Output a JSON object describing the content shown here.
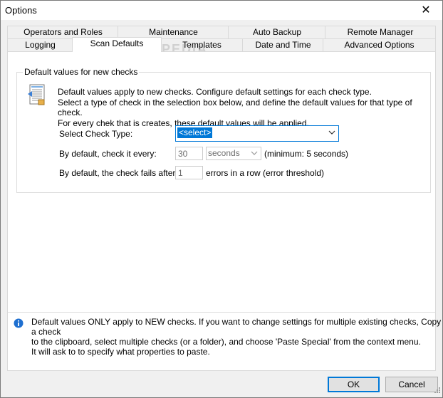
{
  "window": {
    "title": "Options",
    "close_glyph": "✕"
  },
  "tabs_back": [
    "Operators and Roles",
    "Maintenance",
    "Auto Backup",
    "Remote Manager"
  ],
  "tabs_front": [
    "Logging",
    "Scan Defaults",
    "Templates",
    "Date and Time",
    "Advanced Options"
  ],
  "selected_tab": "Scan Defaults",
  "watermark": "SOFTPEDIA",
  "group": {
    "label": "Default values for new checks",
    "description": [
      "Default values apply to new checks. Configure default settings for each check type.",
      "Select a type of check in the selection box below, and define the default values for that type of check.",
      "For every chek that is creates, these default values will be applied."
    ],
    "check_type_label": "Select Check Type:",
    "check_type_value": "<select>",
    "interval_label": "By default, check it every:",
    "interval_value": "30",
    "interval_unit": "seconds",
    "interval_note": "(minimum: 5 seconds)",
    "fails_label": "By default, the check fails after:",
    "fails_value": "1",
    "fails_note": "errors in a row (error threshold)"
  },
  "info": [
    "Default values ONLY apply to NEW checks. If you want to change settings for multiple existing checks, Copy a check",
    "to the clipboard, select multiple checks (or a folder), and choose 'Paste Special' from the context menu.",
    "It will ask to to specify what properties to paste."
  ],
  "buttons": {
    "ok": "OK",
    "cancel": "Cancel"
  },
  "icons": {
    "document": "document-icon",
    "info": "info-icon",
    "close": "close-icon",
    "dropdown": "chevron-down-icon"
  },
  "colors": {
    "accent": "#0078d7",
    "info_blue": "#1e6fd0"
  }
}
